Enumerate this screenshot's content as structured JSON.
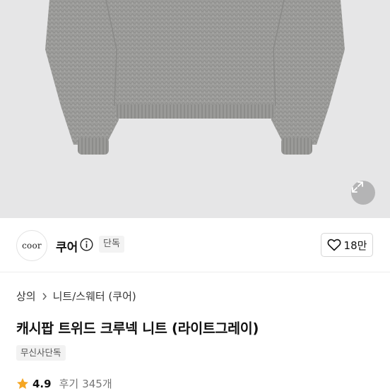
{
  "product_image": {
    "alt_icon": "sweater-image",
    "zoom_icon": "expand-icon"
  },
  "brand": {
    "logo_text": "coor",
    "name": "쿠어",
    "badge": "단독",
    "likes": "18만"
  },
  "breadcrumb": {
    "items": [
      "상의",
      "니트/스웨터 (쿠어)"
    ]
  },
  "product": {
    "title": "캐시팝 트위드 크루넥 니트 (라이트그레이)",
    "tag": "무신사단독"
  },
  "rating": {
    "value": "4.9",
    "review_label": "후기",
    "review_count": "345개"
  },
  "colors": {
    "star": "#f5a623",
    "hero_bg": "#e6e6e7",
    "sweater": "#9a9a98"
  }
}
